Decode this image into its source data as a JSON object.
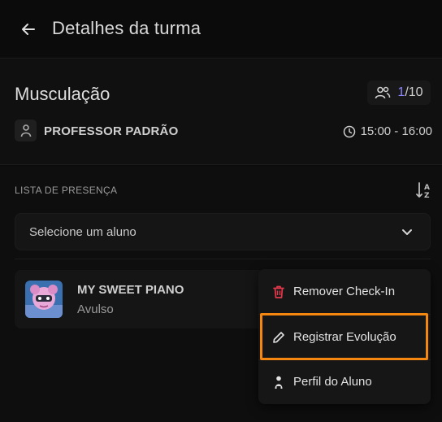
{
  "header": {
    "title": "Detalhes da turma"
  },
  "class_info": {
    "name": "Musculação",
    "capacity_current": "1",
    "capacity_total": "/10",
    "professor": "PROFESSOR PADRÃO",
    "schedule": "15:00 - 16:00"
  },
  "attendance": {
    "label": "LISTA DE PRESENÇA",
    "select_placeholder": "Selecione um aluno",
    "students": [
      {
        "name": "MY SWEET PIANO",
        "type": "Avulso"
      }
    ]
  },
  "menu": {
    "items": [
      {
        "label": "Remover Check-In",
        "icon": "trash-icon",
        "color": "#e0394b"
      },
      {
        "label": "Registrar Evolução",
        "icon": "pencil-icon",
        "highlighted": true
      },
      {
        "label": "Perfil do Aluno",
        "icon": "user-icon"
      }
    ]
  },
  "colors": {
    "accent": "#8b85ff",
    "highlight": "#f5860f",
    "danger": "#e0394b"
  }
}
